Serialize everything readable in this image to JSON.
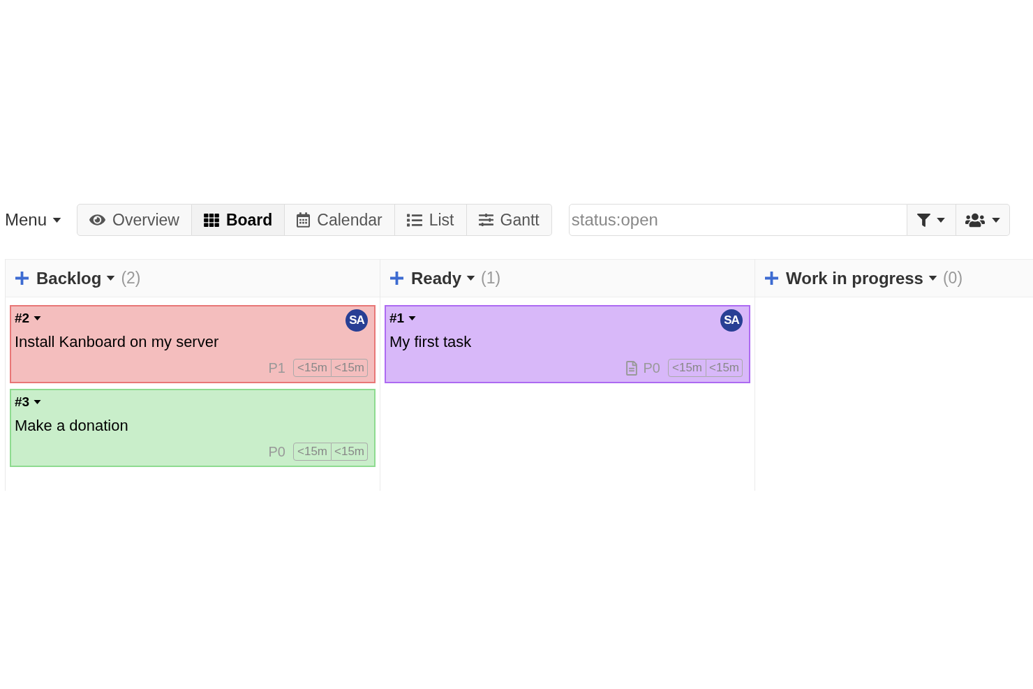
{
  "toolbar": {
    "menu": {
      "label": "Menu"
    },
    "views": [
      {
        "kind": "overview",
        "label": "Overview",
        "selected": false
      },
      {
        "kind": "board",
        "label": "Board",
        "selected": true
      },
      {
        "kind": "calendar",
        "label": "Calendar",
        "selected": false
      },
      {
        "kind": "list",
        "label": "List",
        "selected": false
      },
      {
        "kind": "gantt",
        "label": "Gantt",
        "selected": false
      }
    ],
    "search": {
      "value": "status:open"
    }
  },
  "columns": [
    {
      "title": "Backlog",
      "count": "(2)",
      "tasks": [
        {
          "id": "#2",
          "title": "Install Kanboard on my server",
          "color": "#f4bebe",
          "assignee": "SA",
          "has_description": false,
          "priority": "P1",
          "times": [
            "<15m",
            "<15m"
          ]
        },
        {
          "id": "#3",
          "title": "Make a donation",
          "color": "#c9eeca",
          "has_description": false,
          "priority": "P0",
          "times": [
            "<15m",
            "<15m"
          ]
        }
      ]
    },
    {
      "title": "Ready",
      "count": "(1)",
      "tasks": [
        {
          "id": "#1",
          "title": "My first task",
          "color": "#d8b8f9",
          "assignee": "SA",
          "has_description": true,
          "priority": "P0",
          "times": [
            "<15m",
            "<15m"
          ]
        }
      ]
    },
    {
      "title": "Work in progress",
      "count": "(0)"
    }
  ]
}
